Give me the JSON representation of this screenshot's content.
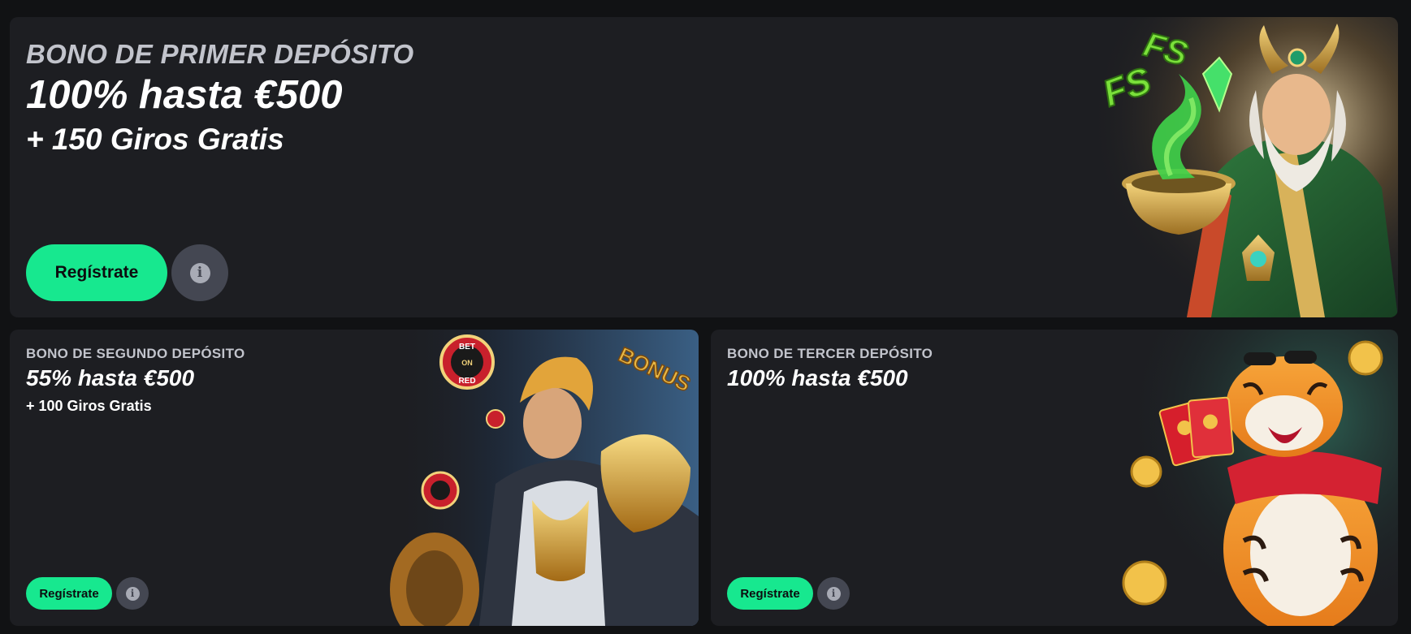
{
  "colors": {
    "page_bg": "#111214",
    "card_bg": "#1d1e22",
    "accent_green": "#17e88f",
    "info_bg": "#444752",
    "kicker_text": "#c2c4cc"
  },
  "promo_main": {
    "kicker": "BONO DE PRIMER DEPÓSITO",
    "headline": "100% hasta €500",
    "subline": "+ 150 Giros Gratis",
    "register_label": "Regístrate",
    "info_icon": "info-icon",
    "art_badge_1": "FS",
    "art_badge_2": "FS"
  },
  "promo_second": {
    "kicker": "BONO DE SEGUNDO DEPÓSITO",
    "headline": "55% hasta €500",
    "subline": "+ 100 Giros Gratis",
    "register_label": "Regístrate",
    "info_icon": "info-icon",
    "art_badge_bonus": "BONUS",
    "art_chip_top": "BET",
    "art_chip_mid": "ON",
    "art_chip_bottom": "RED"
  },
  "promo_third": {
    "kicker": "BONO DE TERCER DEPÓSITO",
    "headline": "100% hasta €500",
    "register_label": "Regístrate",
    "info_icon": "info-icon"
  }
}
